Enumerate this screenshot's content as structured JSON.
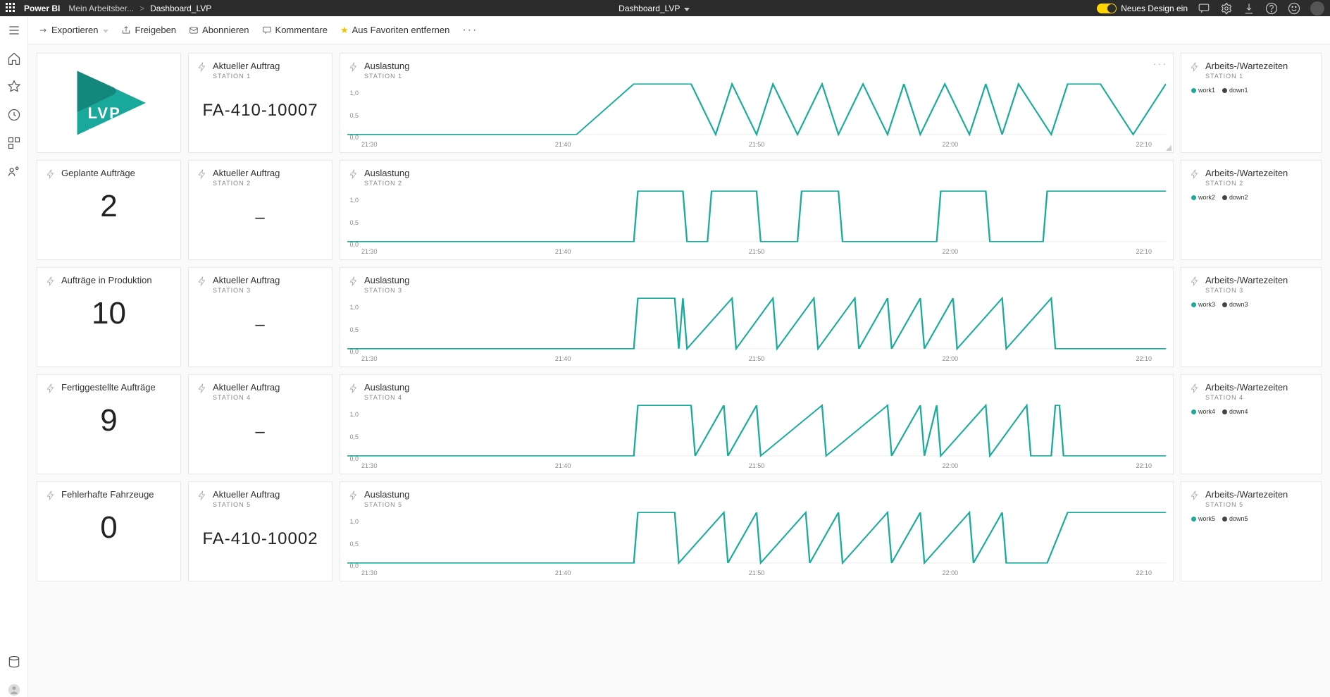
{
  "topbar": {
    "brand": "Power BI",
    "bc_workspace": "Mein Arbeitsber...",
    "bc_current": "Dashboard_LVP",
    "center_title": "Dashboard_LVP",
    "toggle_label": "Neues Design ein"
  },
  "toolbar": {
    "export": "Exportieren",
    "share": "Freigeben",
    "subscribe": "Abonnieren",
    "comments": "Kommentare",
    "favorite": "Aus Favoriten entfernen"
  },
  "tiles": {
    "planned_orders": {
      "title": "Geplante Aufträge",
      "value": "2"
    },
    "in_production": {
      "title": "Aufträge in Produktion",
      "value": "10"
    },
    "finished": {
      "title": "Fertiggestellte Aufträge",
      "value": "9"
    },
    "faulty": {
      "title": "Fehlerhafte Fahrzeuge",
      "value": "0"
    },
    "current_order": {
      "title": "Aktueller Auftrag",
      "stations": [
        "STATION 1",
        "STATION 2",
        "STATION 3",
        "STATION 4",
        "STATION 5"
      ],
      "values": [
        "FA-410-10007",
        "–",
        "–",
        "–",
        "FA-410-10002"
      ]
    },
    "utilization": {
      "title": "Auslastung"
    },
    "worktimes": {
      "title": "Arbeits-/Wartezeiten",
      "legends": [
        [
          "work1",
          "down1"
        ],
        [
          "work2",
          "down2"
        ],
        [
          "work3",
          "down3"
        ],
        [
          "work4",
          "down4"
        ],
        [
          "work5",
          "down5"
        ]
      ]
    }
  },
  "chart_data": [
    {
      "type": "line",
      "title": "Auslastung – Station 1",
      "ylim": [
        0,
        1
      ],
      "xticks": [
        "21:30",
        "21:40",
        "21:50",
        "22:00",
        "22:10"
      ],
      "yticks": [
        "1,0",
        "0,5",
        "0,0"
      ],
      "x": [
        0,
        0.28,
        0.35,
        0.42,
        0.45,
        0.47,
        0.5,
        0.52,
        0.55,
        0.58,
        0.6,
        0.63,
        0.66,
        0.68,
        0.7,
        0.73,
        0.76,
        0.78,
        0.8,
        0.82,
        0.86,
        0.88,
        0.92,
        0.96,
        1.0
      ],
      "y": [
        0,
        0,
        1,
        1,
        0,
        1,
        0,
        1,
        0,
        1,
        0,
        1,
        0,
        1,
        0,
        1,
        0,
        1,
        0,
        1,
        0,
        1,
        1,
        0,
        1
      ]
    },
    {
      "type": "line",
      "title": "Auslastung – Station 2",
      "ylim": [
        0,
        1
      ],
      "xticks": [
        "21:30",
        "21:40",
        "21:50",
        "22:00",
        "22:10"
      ],
      "yticks": [
        "1,0",
        "0,5",
        "0,0"
      ],
      "x": [
        0,
        0.35,
        0.355,
        0.41,
        0.415,
        0.44,
        0.445,
        0.5,
        0.505,
        0.55,
        0.555,
        0.6,
        0.605,
        0.72,
        0.725,
        0.78,
        0.785,
        0.85,
        0.855,
        1.0
      ],
      "y": [
        0,
        0,
        1,
        1,
        0,
        0,
        1,
        1,
        0,
        0,
        1,
        1,
        0,
        0,
        1,
        1,
        0,
        0,
        1,
        1
      ]
    },
    {
      "type": "line",
      "title": "Auslastung – Station 3",
      "ylim": [
        0,
        1
      ],
      "xticks": [
        "21:30",
        "21:40",
        "21:50",
        "22:00",
        "22:10"
      ],
      "yticks": [
        "1,0",
        "0,5",
        "0,0"
      ],
      "x": [
        0,
        0.35,
        0.355,
        0.4,
        0.405,
        0.41,
        0.415,
        0.47,
        0.475,
        0.52,
        0.525,
        0.57,
        0.575,
        0.62,
        0.625,
        0.66,
        0.665,
        0.7,
        0.705,
        0.74,
        0.745,
        0.8,
        0.805,
        0.86,
        0.865,
        1.0
      ],
      "y": [
        0,
        0,
        1,
        1,
        0,
        1,
        0,
        1,
        0,
        1,
        0,
        1,
        0,
        1,
        0,
        1,
        0,
        1,
        0,
        1,
        0,
        1,
        0,
        1,
        0,
        0
      ]
    },
    {
      "type": "line",
      "title": "Auslastung – Station 4",
      "ylim": [
        0,
        1
      ],
      "xticks": [
        "21:30",
        "21:40",
        "21:50",
        "22:00",
        "22:10"
      ],
      "yticks": [
        "1,0",
        "0,5",
        "0,0"
      ],
      "x": [
        0,
        0.35,
        0.355,
        0.42,
        0.425,
        0.46,
        0.465,
        0.5,
        0.505,
        0.58,
        0.585,
        0.66,
        0.665,
        0.7,
        0.705,
        0.72,
        0.725,
        0.78,
        0.785,
        0.83,
        0.835,
        0.86,
        0.865,
        0.87,
        0.875,
        1.0
      ],
      "y": [
        0,
        0,
        1,
        1,
        0,
        1,
        0,
        1,
        0,
        1,
        0,
        1,
        0,
        1,
        0,
        1,
        0,
        1,
        0,
        1,
        0,
        0,
        1,
        1,
        0,
        0
      ]
    },
    {
      "type": "line",
      "title": "Auslastung – Station 5",
      "ylim": [
        0,
        1
      ],
      "xticks": [
        "21:30",
        "21:40",
        "21:50",
        "22:00",
        "22:10"
      ],
      "yticks": [
        "1,0",
        "0,5",
        "0,0"
      ],
      "x": [
        0,
        0.35,
        0.355,
        0.4,
        0.405,
        0.46,
        0.465,
        0.5,
        0.505,
        0.56,
        0.565,
        0.6,
        0.605,
        0.66,
        0.665,
        0.7,
        0.705,
        0.76,
        0.765,
        0.8,
        0.805,
        0.85,
        0.855,
        0.88,
        0.885,
        1.0
      ],
      "y": [
        0,
        0,
        1,
        1,
        0,
        1,
        0,
        1,
        0,
        1,
        0,
        1,
        0,
        1,
        0,
        1,
        0,
        1,
        0,
        1,
        0,
        0,
        0,
        1,
        1,
        1
      ]
    }
  ]
}
